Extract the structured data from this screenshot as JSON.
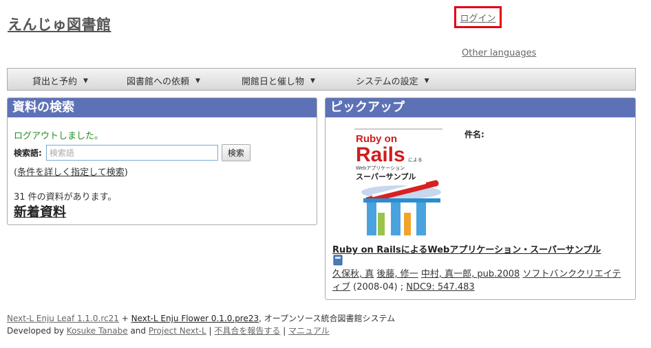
{
  "header": {
    "site_title": "えんじゅ図書館",
    "login_label": "ログイン",
    "other_languages": "Other languages"
  },
  "nav": {
    "items": [
      {
        "label": "貸出と予約"
      },
      {
        "label": "図書館への依頼"
      },
      {
        "label": "開館日と催し物"
      },
      {
        "label": "システムの設定"
      }
    ]
  },
  "search_panel": {
    "title": "資料の検索",
    "logout_message": "ログアウトしました。",
    "search_label": "検索語:",
    "search_placeholder": "検索語",
    "search_button": "検索",
    "adv_prefix": "(",
    "adv_link": "条件を詳しく指定して検索",
    "adv_suffix": ")",
    "count_text": "31 件の資料があります。",
    "new_items": "新着資料"
  },
  "pickup_panel": {
    "title": "ピックアップ",
    "item_name_label": "件名:",
    "cover": {
      "line_ruby_on": "Ruby on",
      "line_rails": "Rails",
      "line_niyoru": "による",
      "line_web": "Webアプリケーション",
      "line_super": "スーパーサンプル"
    },
    "book_title": "Ruby on RailsによるWebアプリケーション・スーパーサンプル",
    "authors": [
      "久保秋, 真",
      "後藤, 修一",
      "中村, 真一郎, pub.2008"
    ],
    "publisher": "ソフトバンククリエイティブ",
    "pub_date": "(2008-04)",
    "separator": ";",
    "ndc": "NDC9: 547.483"
  },
  "footer": {
    "leaf": "Next-L Enju Leaf 1.1.0.rc21",
    "plus": "+",
    "flower": "Next-L Enju Flower 0.1.0.pre23",
    "desc": ", オープンソース統合図書館システム",
    "developed_by": "Developed by",
    "dev1": "Kosuke Tanabe",
    "and": "and",
    "dev2": "Project Next-L",
    "pipe": "|",
    "report": "不具合を報告する",
    "manual": "マニュアル"
  },
  "colors": {
    "panel_header": "#5d72b6",
    "login_highlight": "#e2000f",
    "logout_message": "#228b22"
  }
}
